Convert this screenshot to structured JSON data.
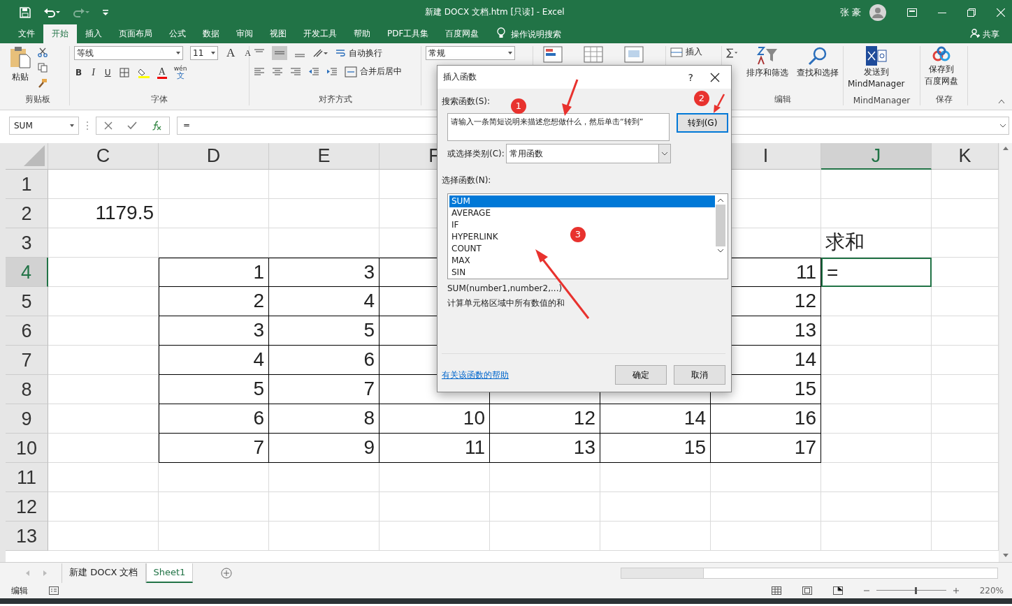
{
  "title_bar": {
    "title": "新建 DOCX 文档.htm  [只读]  -  Excel",
    "user": "张 豪"
  },
  "tabs": [
    {
      "label": "文件",
      "selected": false
    },
    {
      "label": "开始",
      "selected": true
    },
    {
      "label": "插入",
      "selected": false
    },
    {
      "label": "页面布局",
      "selected": false
    },
    {
      "label": "公式",
      "selected": false
    },
    {
      "label": "数据",
      "selected": false
    },
    {
      "label": "审阅",
      "selected": false
    },
    {
      "label": "视图",
      "selected": false
    },
    {
      "label": "开发工具",
      "selected": false
    },
    {
      "label": "帮助",
      "selected": false
    },
    {
      "label": "PDF工具集",
      "selected": false
    },
    {
      "label": "百度网盘",
      "selected": false
    }
  ],
  "tell_me": "操作说明搜索",
  "share": "共享",
  "ribbon": {
    "clipboard": {
      "paste": "粘贴",
      "label": "剪贴板"
    },
    "font": {
      "family": "等线",
      "size": "11",
      "grow": "A",
      "shrink": "A",
      "bold": "B",
      "italic": "I",
      "underline": "U",
      "font_color_letter": "A",
      "phonetic_top": "wén",
      "phonetic_bottom": "文",
      "label": "字体"
    },
    "alignment": {
      "wrap": "自动换行",
      "merge": "合并后居中",
      "label": "对齐方式"
    },
    "number": {
      "format": "常规"
    },
    "cells": {
      "insert": "插入"
    },
    "editing": {
      "sort": "排序和筛选",
      "find": "查找和选择",
      "label": "编辑"
    },
    "mindmanager": {
      "lines": [
        "发送到",
        "MindManager"
      ],
      "label": "MindManager"
    },
    "save": {
      "lines": [
        "保存到",
        "百度网盘"
      ],
      "label": "保存"
    }
  },
  "formula_bar": {
    "name_box": "SUM",
    "formula": "="
  },
  "columns": [
    {
      "label": "C",
      "selected": false
    },
    {
      "label": "D",
      "selected": false
    },
    {
      "label": "E",
      "selected": false
    },
    {
      "label": "F",
      "selected": false
    },
    null,
    null,
    {
      "label": "I",
      "selected": false
    },
    {
      "label": "J",
      "selected": true
    },
    {
      "label": "K",
      "selected": false
    }
  ],
  "rows": [
    {
      "label": "1",
      "selected": false,
      "bordered": false,
      "cells": [
        null,
        null,
        null,
        null,
        null,
        null,
        null,
        null,
        null
      ]
    },
    {
      "label": "2",
      "selected": false,
      "bordered": false,
      "cells": [
        {
          "text": "1179.5",
          "kind": "number"
        },
        null,
        null,
        null,
        null,
        null,
        null,
        null,
        null
      ]
    },
    {
      "label": "3",
      "selected": false,
      "bordered": false,
      "cells": [
        null,
        null,
        null,
        null,
        null,
        null,
        null,
        {
          "text": "求和",
          "kind": "text"
        },
        null
      ]
    },
    {
      "label": "4",
      "selected": true,
      "bordered": true,
      "cells": [
        null,
        {
          "text": "1",
          "kind": "number"
        },
        {
          "text": "3",
          "kind": "number"
        },
        null,
        null,
        null,
        {
          "text": "11",
          "kind": "number"
        },
        {
          "text": "=",
          "kind": "text"
        },
        null
      ]
    },
    {
      "label": "5",
      "selected": false,
      "bordered": true,
      "cells": [
        null,
        {
          "text": "2",
          "kind": "number"
        },
        {
          "text": "4",
          "kind": "number"
        },
        null,
        null,
        null,
        {
          "text": "12",
          "kind": "number"
        },
        null,
        null
      ]
    },
    {
      "label": "6",
      "selected": false,
      "bordered": true,
      "cells": [
        null,
        {
          "text": "3",
          "kind": "number"
        },
        {
          "text": "5",
          "kind": "number"
        },
        null,
        null,
        null,
        {
          "text": "13",
          "kind": "number"
        },
        null,
        null
      ]
    },
    {
      "label": "7",
      "selected": false,
      "bordered": true,
      "cells": [
        null,
        {
          "text": "4",
          "kind": "number"
        },
        {
          "text": "6",
          "kind": "number"
        },
        null,
        null,
        null,
        {
          "text": "14",
          "kind": "number"
        },
        null,
        null
      ]
    },
    {
      "label": "8",
      "selected": false,
      "bordered": true,
      "cells": [
        null,
        {
          "text": "5",
          "kind": "number"
        },
        {
          "text": "7",
          "kind": "number"
        },
        null,
        null,
        null,
        {
          "text": "15",
          "kind": "number"
        },
        null,
        null
      ]
    },
    {
      "label": "9",
      "selected": false,
      "bordered": true,
      "cells": [
        null,
        {
          "text": "6",
          "kind": "number"
        },
        {
          "text": "8",
          "kind": "number"
        },
        {
          "text": "10",
          "kind": "number"
        },
        {
          "text": "12",
          "kind": "number"
        },
        {
          "text": "14",
          "kind": "number"
        },
        {
          "text": "16",
          "kind": "number"
        },
        null,
        null
      ]
    },
    {
      "label": "10",
      "selected": false,
      "bordered": true,
      "cells": [
        null,
        {
          "text": "7",
          "kind": "number"
        },
        {
          "text": "9",
          "kind": "number"
        },
        {
          "text": "11",
          "kind": "number"
        },
        {
          "text": "13",
          "kind": "number"
        },
        {
          "text": "15",
          "kind": "number"
        },
        {
          "text": "17",
          "kind": "number"
        },
        null,
        null
      ]
    },
    {
      "label": "11",
      "selected": false,
      "bordered": false,
      "cells": [
        null,
        null,
        null,
        null,
        null,
        null,
        null,
        null,
        null
      ]
    },
    {
      "label": "12",
      "selected": false,
      "bordered": false,
      "cells": [
        null,
        null,
        null,
        null,
        null,
        null,
        null,
        null,
        null
      ]
    },
    {
      "label": "13",
      "selected": false,
      "bordered": false,
      "cells": [
        null,
        null,
        null,
        null,
        null,
        null,
        null,
        null,
        null
      ]
    }
  ],
  "sheets": [
    {
      "label": "新建 DOCX 文档",
      "selected": false
    },
    {
      "label": "Sheet1",
      "selected": true
    }
  ],
  "status_bar": {
    "mode": "编辑",
    "zoom": "220%",
    "zoom_slider": {
      "level": 0.55
    }
  },
  "dialog": {
    "title": "插入函数",
    "help": "?",
    "search_label": "搜索函数(S):",
    "search_value": "请输入一条简短说明来描述您想做什么，然后单击“转到”",
    "go": "转到(G)",
    "category_label": "或选择类别(C):",
    "category": "常用函数",
    "list_label": "选择函数(N):",
    "functions": [
      {
        "label": "SUM",
        "selected": true
      },
      {
        "label": "AVERAGE",
        "selected": false
      },
      {
        "label": "IF",
        "selected": false
      },
      {
        "label": "HYPERLINK",
        "selected": false
      },
      {
        "label": "COUNT",
        "selected": false
      },
      {
        "label": "MAX",
        "selected": false
      },
      {
        "label": "SIN",
        "selected": false
      }
    ],
    "signature": "SUM(number1,number2,...)",
    "description": "计算单元格区域中所有数值的和",
    "help_link": "有关该函数的帮助",
    "ok": "确定",
    "cancel": "取消"
  },
  "annotations": [
    "1",
    "2",
    "3"
  ]
}
